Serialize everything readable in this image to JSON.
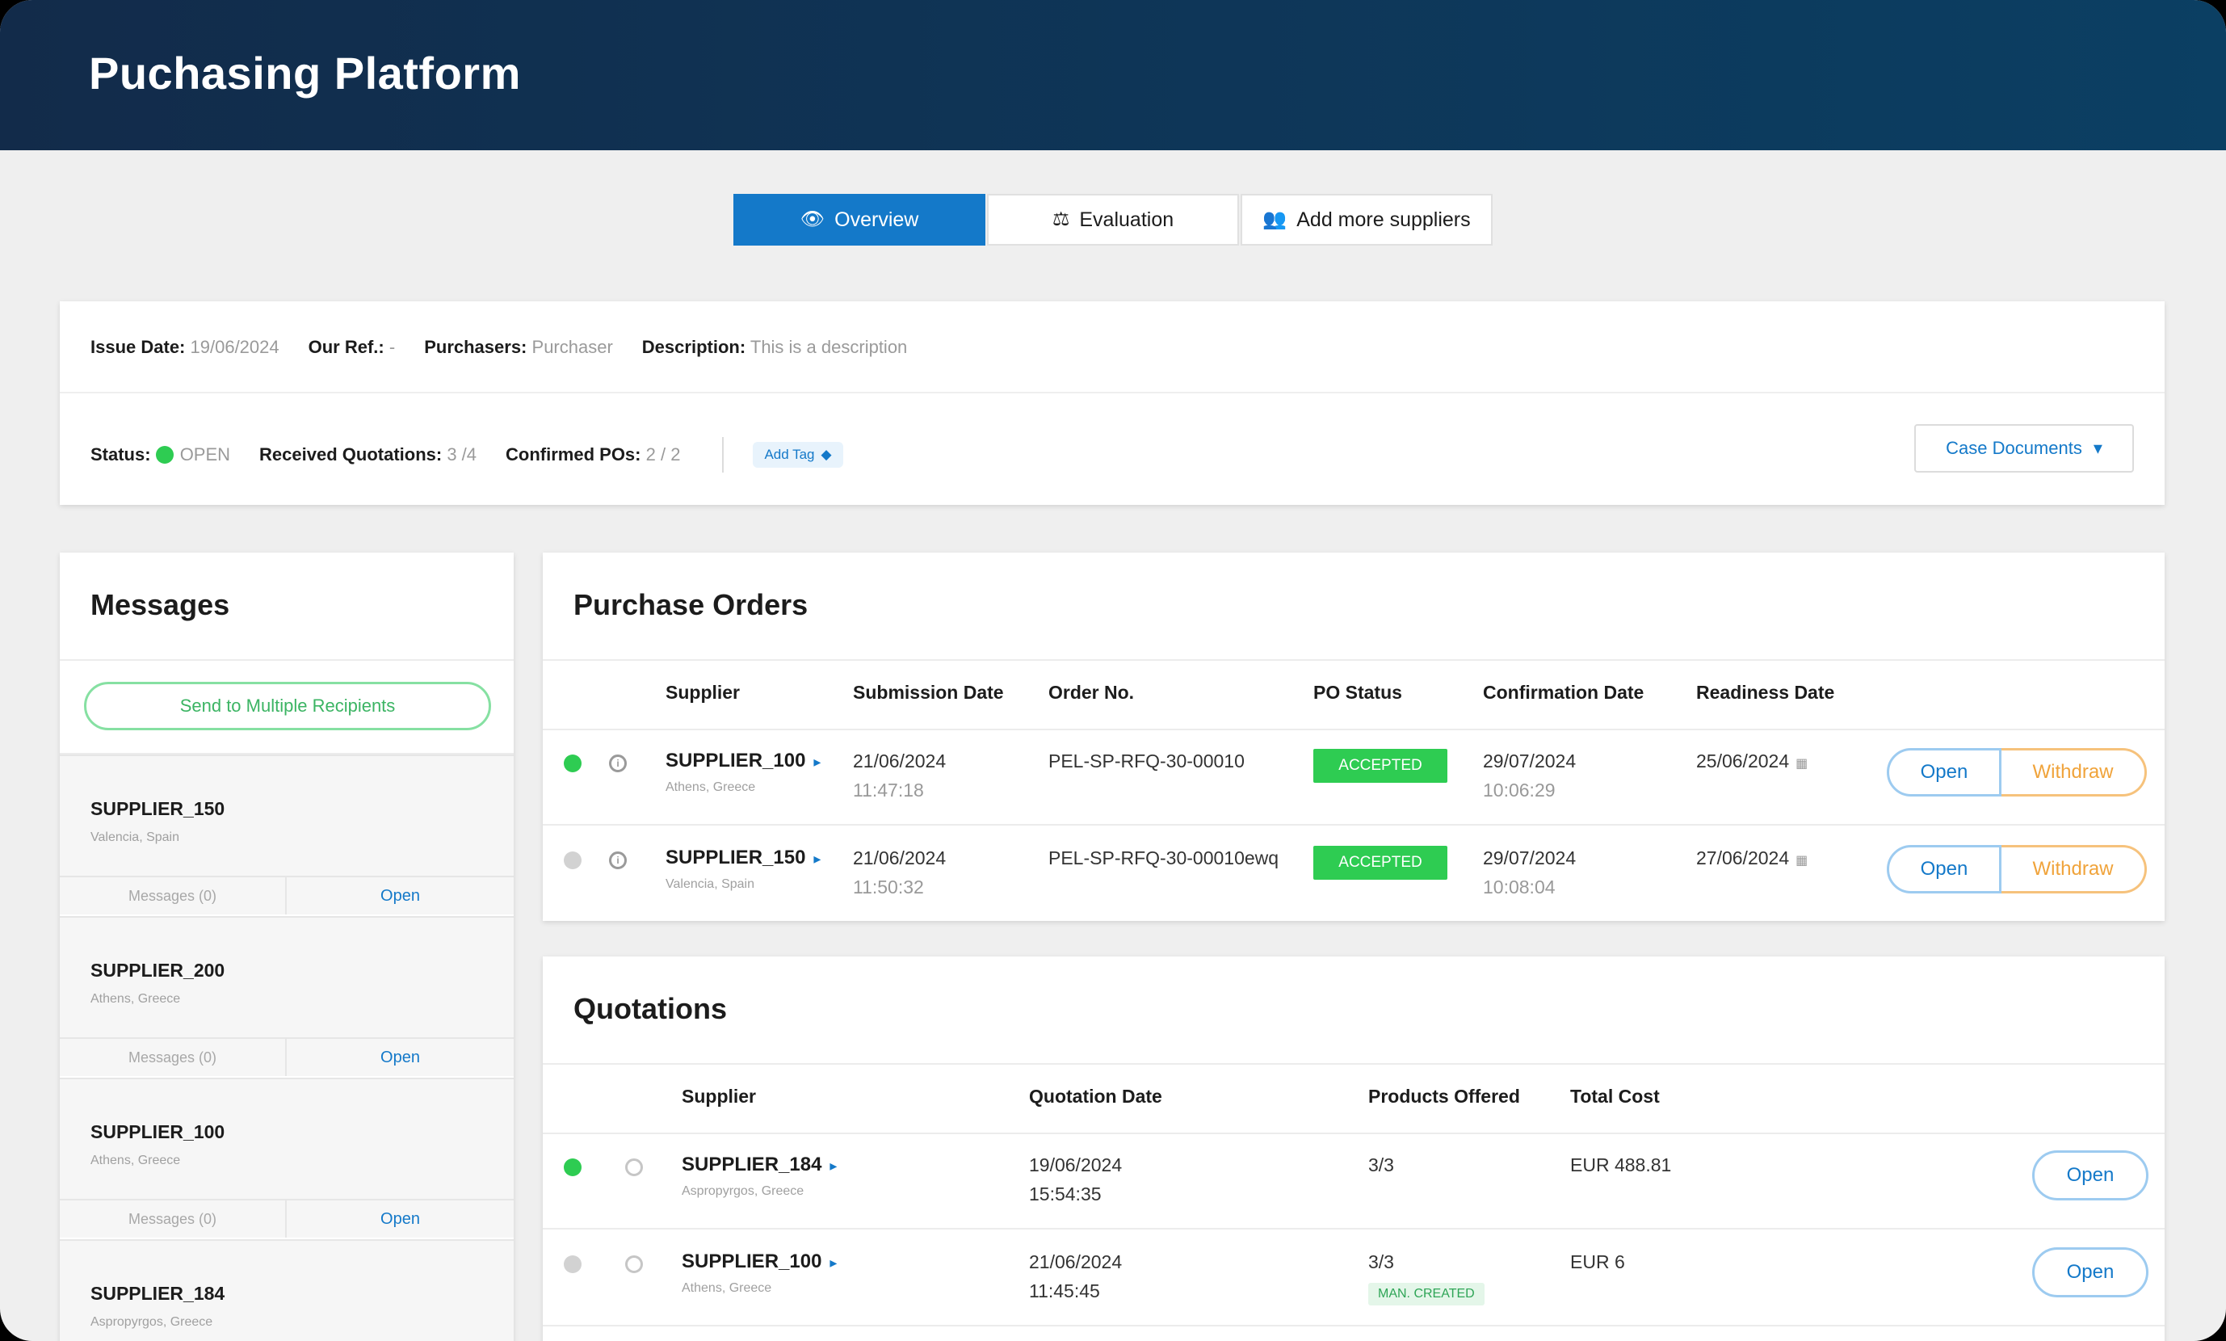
{
  "app": {
    "title": "Puchasing Platform"
  },
  "tabs": [
    {
      "label": "Overview",
      "icon": "eye-icon",
      "glyph": "👁"
    },
    {
      "label": "Evaluation",
      "icon": "scale-icon",
      "glyph": "⚖"
    },
    {
      "label": "Add more suppliers",
      "icon": "users-icon",
      "glyph": "👥"
    }
  ],
  "info": {
    "issue_date_label": "Issue Date:",
    "issue_date": "19/06/2024",
    "our_ref_label": "Our Ref.:",
    "our_ref": "-",
    "purchasers_label": "Purchasers:",
    "purchasers": "Purchaser",
    "description_label": "Description:",
    "description": "This is a description",
    "status_label": "Status:",
    "status": "OPEN",
    "received_label": "Received Quotations:",
    "received": "3 /4",
    "confirmed_label": "Confirmed POs:",
    "confirmed": "2 / 2",
    "add_tag": "Add Tag",
    "case_documents": "Case Documents"
  },
  "messages": {
    "title": "Messages",
    "send_multiple": "Send to Multiple Recipients",
    "items": [
      {
        "name": "SUPPLIER_150",
        "location": "Valencia, Spain",
        "messages": "Messages (0)",
        "open": "Open"
      },
      {
        "name": "SUPPLIER_200",
        "location": "Athens, Greece",
        "messages": "Messages (0)",
        "open": "Open"
      },
      {
        "name": "SUPPLIER_100",
        "location": "Athens, Greece",
        "messages": "Messages (0)",
        "open": "Open"
      },
      {
        "name": "SUPPLIER_184",
        "location": "Aspropyrgos, Greece",
        "messages": "",
        "open": ""
      }
    ]
  },
  "purchase_orders": {
    "title": "Purchase Orders",
    "headers": [
      "Supplier",
      "Submission Date",
      "Order No.",
      "PO Status",
      "Confirmation Date",
      "Readiness Date"
    ],
    "rows": [
      {
        "supplier": "SUPPLIER_100",
        "location": "Athens, Greece",
        "submission_date": "21/06/2024",
        "submission_time": "11:47:18",
        "order_no": "PEL-SP-RFQ-30-00010",
        "status": "ACCEPTED",
        "confirmation_date": "29/07/2024",
        "confirmation_time": "10:06:29",
        "readiness_date": "25/06/2024",
        "open": "Open",
        "withdraw": "Withdraw",
        "active": true
      },
      {
        "supplier": "SUPPLIER_150",
        "location": "Valencia, Spain",
        "submission_date": "21/06/2024",
        "submission_time": "11:50:32",
        "order_no": "PEL-SP-RFQ-30-00010ewq",
        "status": "ACCEPTED",
        "confirmation_date": "29/07/2024",
        "confirmation_time": "10:08:04",
        "readiness_date": "27/06/2024",
        "open": "Open",
        "withdraw": "Withdraw",
        "active": false
      }
    ]
  },
  "quotations": {
    "title": "Quotations",
    "headers": [
      "Supplier",
      "Quotation Date",
      "Products Offered",
      "Total Cost"
    ],
    "rows": [
      {
        "supplier": "SUPPLIER_184",
        "location": "Aspropyrgos, Greece",
        "date": "19/06/2024",
        "time": "15:54:35",
        "products": "3/3",
        "badge": "",
        "total": "EUR 488.81",
        "open": "Open",
        "active": true
      },
      {
        "supplier": "SUPPLIER_100",
        "location": "Athens, Greece",
        "date": "21/06/2024",
        "time": "11:45:45",
        "products": "3/3",
        "badge": "MAN. CREATED",
        "total": "EUR 6",
        "open": "Open",
        "active": false
      }
    ]
  },
  "colors": {
    "accent": "#1479c9",
    "success": "#2ecc52",
    "warning": "#f0a33a",
    "header": "#122b4a"
  }
}
